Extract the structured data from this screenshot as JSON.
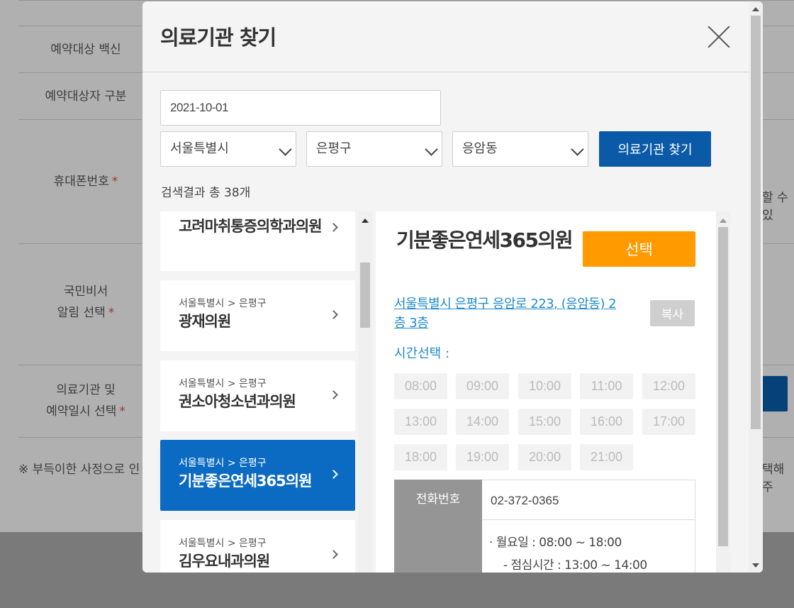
{
  "background": {
    "form_labels": [
      {
        "text": "예약대상 백신",
        "required": false
      },
      {
        "text": "예약대상자 구분",
        "required": false
      },
      {
        "text": "휴대폰번호",
        "required": true
      },
      {
        "text": "국민비서",
        "text2": "알림 선택",
        "required": true
      },
      {
        "text": "의료기관 및",
        "text2": "예약일시 선택",
        "required": true
      }
    ],
    "notice": "※ 부득이한 사정으로 인",
    "right_text": "할 수 있",
    "right_text2": "택해주"
  },
  "modal": {
    "title": "의료기관 찾기",
    "date_value": "2021-10-01",
    "selects": {
      "city": "서울특별시",
      "district": "은평구",
      "dong": "응암동"
    },
    "search_button": "의료기관 찾기",
    "result_count": "검색결과 총 38개",
    "list": [
      {
        "region": "",
        "name": "고려마취통증의학과의원",
        "active": false
      },
      {
        "region": "서울특별시 > 은평구",
        "name": "광재의원",
        "active": false
      },
      {
        "region": "서울특별시 > 은평구",
        "name": "권소아청소년과의원",
        "active": false
      },
      {
        "region": "서울특별시 > 은평구",
        "name": "기분좋은연세365의원",
        "active": true
      },
      {
        "region": "서울특별시 > 은평구",
        "name": "김우요내과의원",
        "active": false
      }
    ],
    "detail": {
      "name": "기분좋은연세365의원",
      "select_button": "선택",
      "address": "서울특별시 은평구 응암로 223, (응암동) 2층 3층",
      "copy_button": "복사",
      "time_label": "시간선택 :",
      "times": [
        "08:00",
        "09:00",
        "10:00",
        "11:00",
        "12:00",
        "13:00",
        "14:00",
        "15:00",
        "16:00",
        "17:00",
        "18:00",
        "19:00",
        "20:00",
        "21:00"
      ],
      "phone_label": "전화번호",
      "phone": "02-372-0365",
      "hours_line1": "· 월요일 : 08:00 ~ 18:00",
      "hours_line2": "- 점심시간 : 13:00 ~ 14:00"
    }
  },
  "colors": {
    "primary": "#0b5aa8",
    "active_item": "#0b6bc3",
    "select_button": "#ff9a00",
    "link": "#1f8bc9"
  }
}
